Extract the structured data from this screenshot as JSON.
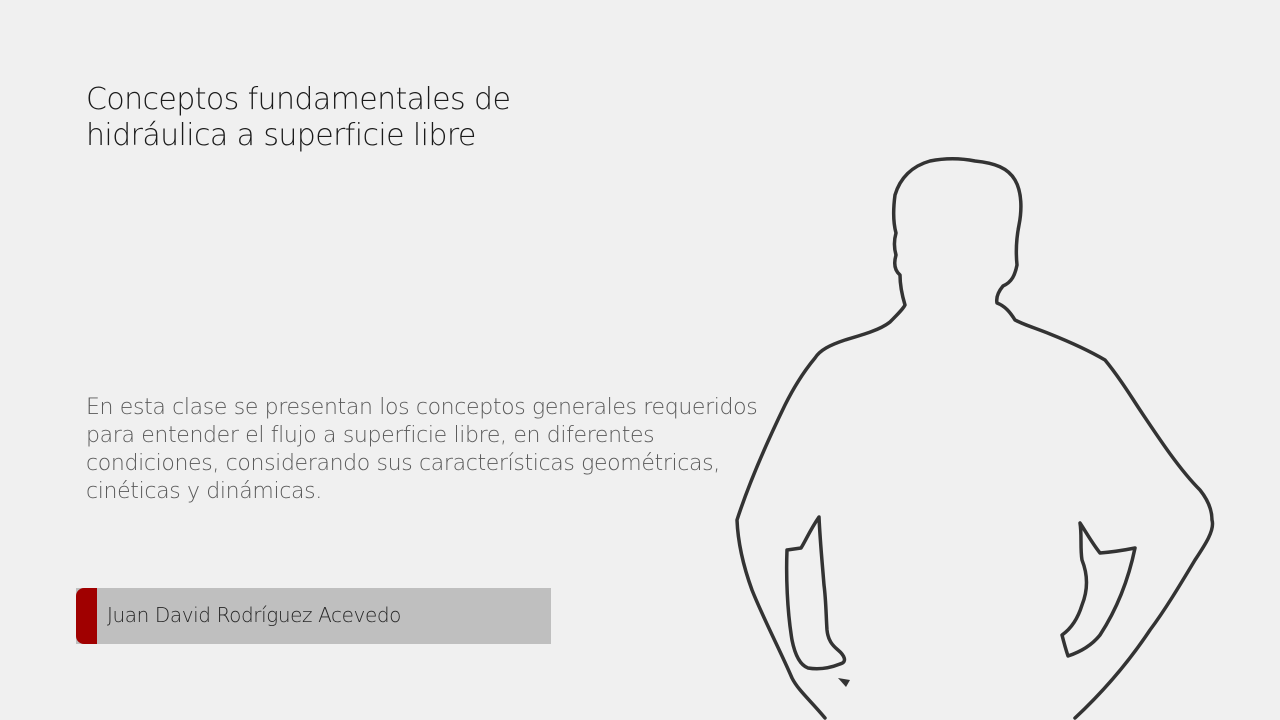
{
  "slide": {
    "title_lines": [
      "Conceptos fundamentales de",
      "hidráulica a superficie libre"
    ],
    "description_lines": [
      "En esta clase se presentan los conceptos generales requeridos",
      "para entender el flujo a superficie libre, en diferentes",
      "condiciones, considerando sus características geométricas,",
      "cinéticas y dinámicas."
    ],
    "author": "Juan David Rodríguez Acevedo",
    "illustration": "person-outline-icon"
  },
  "colors": {
    "background": "#f0f0f0",
    "accent": "#a00000",
    "author_bar": "#bfbfbf",
    "title_text": "#1a1a1a",
    "body_text": "#595959",
    "outline": "#333333"
  }
}
